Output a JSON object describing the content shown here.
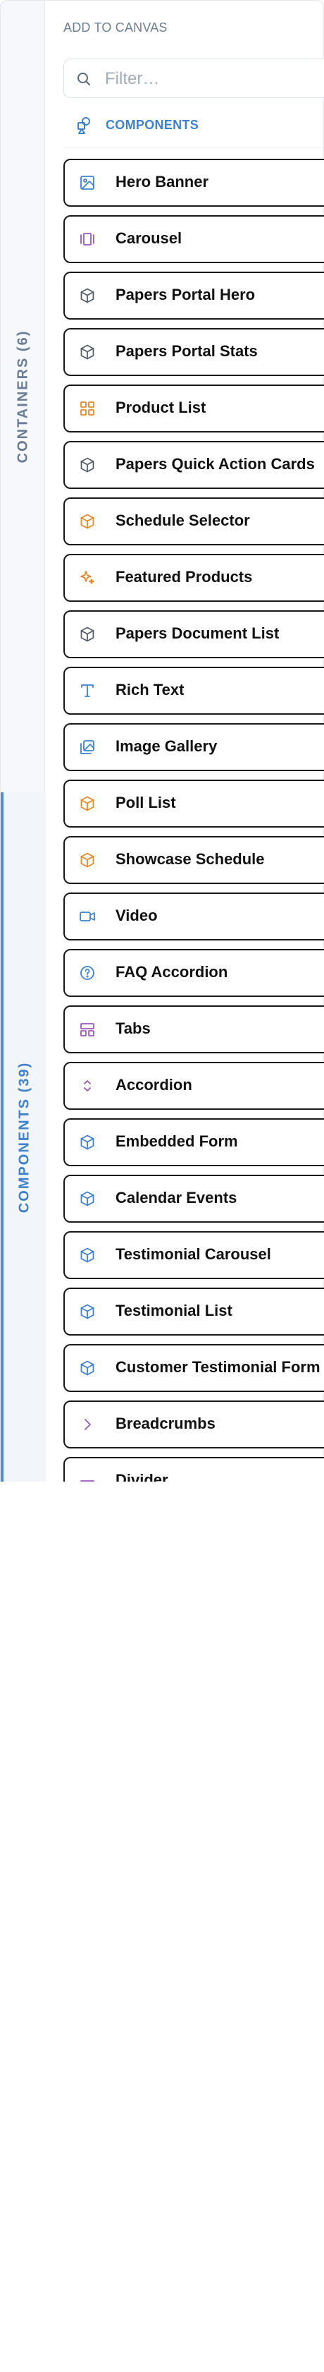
{
  "rail": {
    "containers_label": "CONTAINERS (6)",
    "components_label": "COMPONENTS (39)"
  },
  "header": {
    "title": "ADD TO CANVAS"
  },
  "search": {
    "placeholder": "Filter…",
    "value": ""
  },
  "section": {
    "label": "COMPONENTS"
  },
  "items": [
    {
      "label": "Hero Banner",
      "icon": "image-icon",
      "color": "#3f82c9"
    },
    {
      "label": "Carousel",
      "icon": "carousel-icon",
      "color": "#9b59b6"
    },
    {
      "label": "Papers Portal Hero",
      "icon": "cube-icon",
      "color": "#555f6b"
    },
    {
      "label": "Papers Portal Stats",
      "icon": "cube-icon",
      "color": "#555f6b"
    },
    {
      "label": "Product List",
      "icon": "grid-icon",
      "color": "#e08a2c"
    },
    {
      "label": "Papers Quick Action Cards",
      "icon": "cube-icon",
      "color": "#555f6b"
    },
    {
      "label": "Schedule Selector",
      "icon": "cube-icon",
      "color": "#e08a2c"
    },
    {
      "label": "Featured Products",
      "icon": "sparkles-icon",
      "color": "#e08a2c"
    },
    {
      "label": "Papers Document List",
      "icon": "cube-icon",
      "color": "#555f6b"
    },
    {
      "label": "Rich Text",
      "icon": "text-icon",
      "color": "#3f82c9"
    },
    {
      "label": "Image Gallery",
      "icon": "gallery-icon",
      "color": "#3f82c9"
    },
    {
      "label": "Poll List",
      "icon": "cube-icon",
      "color": "#e08a2c"
    },
    {
      "label": "Showcase Schedule",
      "icon": "cube-icon",
      "color": "#e08a2c"
    },
    {
      "label": "Video",
      "icon": "video-icon",
      "color": "#3f82c9"
    },
    {
      "label": "FAQ Accordion",
      "icon": "question-icon",
      "color": "#3f82c9"
    },
    {
      "label": "Tabs",
      "icon": "tabs-icon",
      "color": "#9b59b6"
    },
    {
      "label": "Accordion",
      "icon": "chevrons-icon",
      "color": "#9b59b6"
    },
    {
      "label": "Embedded Form",
      "icon": "cube-icon",
      "color": "#3f82c9"
    },
    {
      "label": "Calendar Events",
      "icon": "cube-icon",
      "color": "#3f82c9"
    },
    {
      "label": "Testimonial Carousel",
      "icon": "cube-icon",
      "color": "#3f82c9"
    },
    {
      "label": "Testimonial List",
      "icon": "cube-icon",
      "color": "#3f82c9"
    },
    {
      "label": "Customer Testimonial Form",
      "icon": "cube-icon",
      "color": "#3f82c9"
    },
    {
      "label": "Breadcrumbs",
      "icon": "chevron-right-icon",
      "color": "#9b59b6"
    },
    {
      "label": "Divider",
      "icon": "divider-icon",
      "color": "#9b59b6"
    }
  ]
}
